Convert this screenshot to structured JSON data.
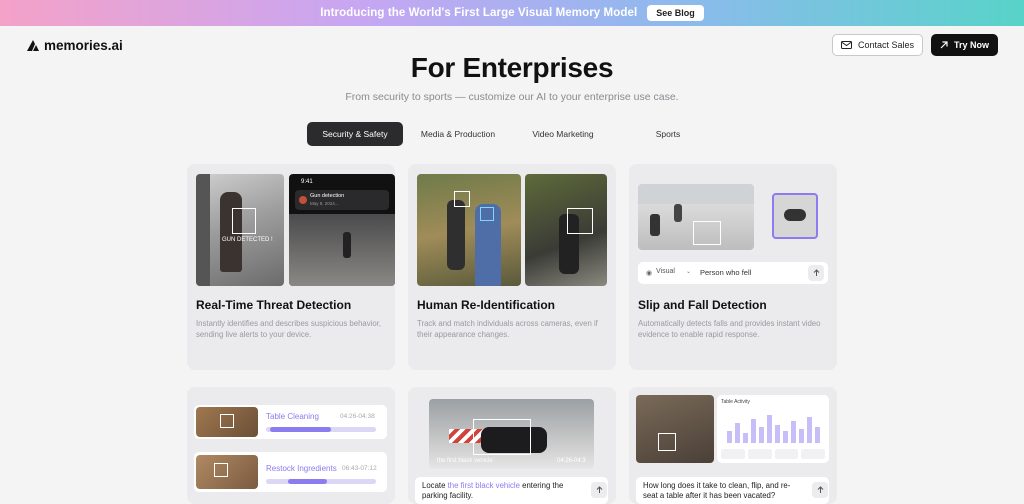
{
  "banner": {
    "text": "Introducing the World's First Large Visual Memory Model",
    "button": "See Blog"
  },
  "nav": {
    "logo": "memories.ai",
    "contact": "Contact Sales",
    "try": "Try Now"
  },
  "hero": {
    "title": "For Enterprises",
    "subtitle": "From security to sports — customize our AI to your enterprise use case."
  },
  "tabs": [
    "Security & Safety",
    "Media & Production",
    "Video Marketing",
    "Sports"
  ],
  "cards": [
    {
      "title": "Real-Time Threat Detection",
      "desc": "Instantly identifies and describes suspicious behavior, sending live alerts to your device."
    },
    {
      "title": "Human Re-Identification",
      "desc": "Track and match individuals across cameras, even if their appearance changes."
    },
    {
      "title": "Slip and Fall Detection",
      "desc": "Automatically detects falls and provides instant video evidence to enable rapid response."
    }
  ],
  "card1": {
    "gun_label": "GUN DETECTED !",
    "phone_time": "9:41",
    "alert_title": "Gun detection",
    "alert_sub": "May 9, 2024..."
  },
  "card3": {
    "visual_label": "Visual",
    "query": "Person who fell"
  },
  "card4": {
    "items": [
      {
        "label": "Table Cleaning",
        "time": "04:26-04:38",
        "progress": 0.55
      },
      {
        "label": "Restock Ingredients",
        "time": "06:43-07:12",
        "progress": 0.35
      }
    ]
  },
  "card5": {
    "overlay": "the first black vehicle",
    "time": "04:26-04:3",
    "query_pre": "Locate ",
    "query_highlight": "the first black vehicle",
    "query_post": " entering the parking facility."
  },
  "card6": {
    "panel_title": "Table Activity",
    "query": "How long does it take to clean, flip, and re-seat a table after it has been vacated?"
  },
  "colors": {
    "accent": "#8b7cf0",
    "dark": "#2b2b2e"
  }
}
